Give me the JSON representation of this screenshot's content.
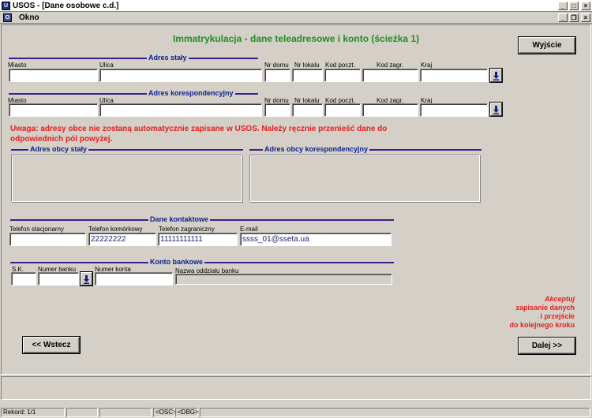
{
  "window": {
    "title": "USOS - [Dane osobowe c.d.]",
    "menu": "Okno",
    "app_icon_text": "U",
    "mdi_icon_text": "O",
    "minimize": "_",
    "maximize": "□",
    "close": "×",
    "restore": "❐"
  },
  "page": {
    "title": "Immatrykulacja - dane teleadresowe i konto (ścieżka 1)"
  },
  "buttons": {
    "exit": "Wyjście",
    "back": "<< Wstecz",
    "next": "Dalej >>"
  },
  "address_permanent": {
    "title": "Adres stały",
    "labels": {
      "city": "Miasto",
      "street": "Ulica",
      "house_no": "Nr domu",
      "apt_no": "Nr lokalu",
      "postal_code": "Kod poczt.",
      "foreign_code": "Kod zagr.",
      "country": "Kraj"
    },
    "values": {
      "city": "",
      "street": "",
      "house_no": "",
      "apt_no": "",
      "postal_code": "",
      "foreign_code": "",
      "country": ""
    }
  },
  "address_correspondence": {
    "title": "Adres korespondencyjny",
    "labels": {
      "city": "Miasto",
      "street": "Ulica",
      "house_no": "Nr domu",
      "apt_no": "Nr lokalu",
      "postal_code": "Kod poczt.",
      "foreign_code": "Kod zagr.",
      "country": "Kraj"
    },
    "values": {
      "city": "",
      "street": "",
      "house_no": "",
      "apt_no": "",
      "postal_code": "",
      "foreign_code": "",
      "country": ""
    }
  },
  "warning": "Uwaga: adresy obce nie zostaną automatycznie zapisane w USOS. Należy ręcznie przenieść dane do odpowiednich pól powyżej.",
  "foreign_permanent": {
    "title": "Adres obcy stały"
  },
  "foreign_correspondence": {
    "title": "Adres obcy korespondencyjny"
  },
  "contact": {
    "title": "Dane kontaktowe",
    "labels": {
      "landline": "Telefon stacjonarny",
      "mobile": "Telefon komórkowy",
      "foreign_phone": "Telefon zagraniczny",
      "email": "E-mail"
    },
    "values": {
      "landline": "",
      "mobile": "22222222",
      "foreign_phone": "11111111111",
      "email": "ssss_01@sseta.ua"
    }
  },
  "bank": {
    "title": "Konto bankowe",
    "labels": {
      "sk": "S.K.",
      "bank_no": "Numer banku",
      "account_no": "Numer konta",
      "branch_name": "Nazwa oddziału banku"
    },
    "values": {
      "sk": "",
      "bank_no": "",
      "account_no": "",
      "branch_name": ""
    }
  },
  "accept_note": {
    "line1": "Akceptuj",
    "line2": "zapisanie danych",
    "line3": "i przejście",
    "line4": "do kolejnego kroku"
  },
  "status": {
    "record": "Rekord: 1/1",
    "osc": "<OSC>",
    "dbg": "<DBG>"
  },
  "colors": {
    "accent_green": "#1e8f1e",
    "warning_red": "#e41e1e",
    "section_line": "#3a1e8c",
    "section_title": "#0b1e8c"
  }
}
